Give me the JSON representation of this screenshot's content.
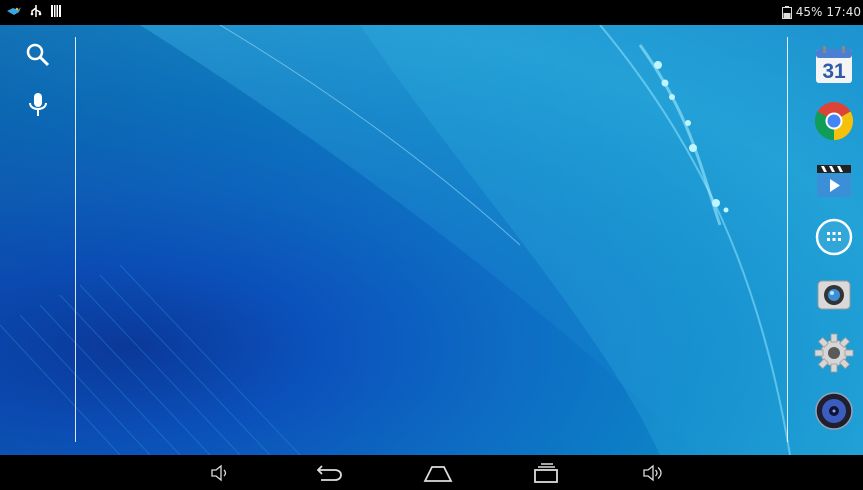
{
  "status_bar": {
    "battery_level": "45%",
    "time": "17:40",
    "left_icons": [
      "notification-bird-icon",
      "usb-icon",
      "storage-icon"
    ],
    "right_icons": [
      "battery-icon"
    ]
  },
  "search_rail": {
    "items": [
      {
        "icon": "search-icon"
      },
      {
        "icon": "microphone-icon"
      }
    ]
  },
  "dock": {
    "items": [
      {
        "icon": "calendar-icon",
        "text": "31"
      },
      {
        "icon": "chrome-icon"
      },
      {
        "icon": "video-player-icon"
      },
      {
        "icon": "app-drawer-icon"
      },
      {
        "icon": "camera-icon"
      },
      {
        "icon": "settings-icon"
      },
      {
        "icon": "music-icon"
      }
    ]
  },
  "nav_bar": {
    "items": [
      {
        "icon": "volume-down-icon"
      },
      {
        "icon": "back-icon"
      },
      {
        "icon": "home-icon"
      },
      {
        "icon": "recent-apps-icon"
      },
      {
        "icon": "volume-up-icon"
      }
    ]
  },
  "colors": {
    "status_bar_bg": "#000000",
    "nav_bar_bg": "#000000",
    "wallpaper_primary": "#0d86c9",
    "wallpaper_deep": "#0b3a9e"
  }
}
